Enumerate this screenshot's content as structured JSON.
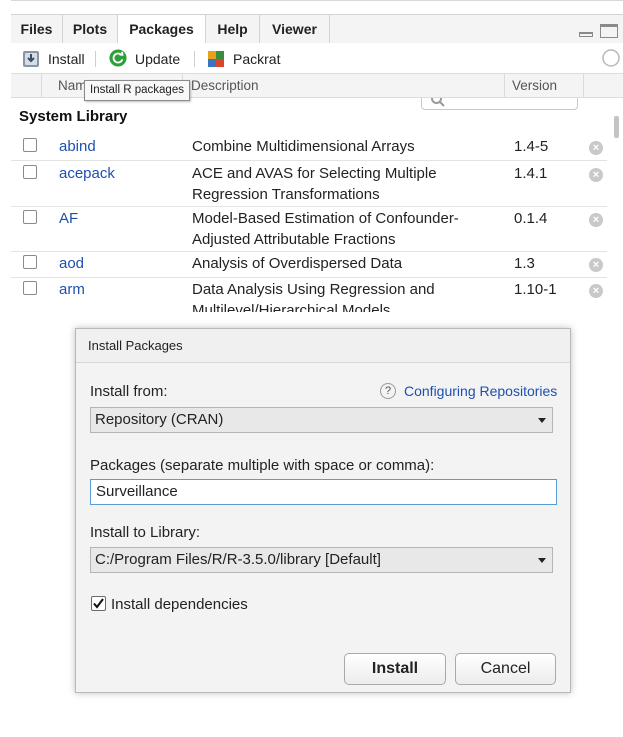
{
  "tabs": [
    {
      "label": "Files",
      "active": false
    },
    {
      "label": "Plots",
      "active": false
    },
    {
      "label": "Packages",
      "active": true
    },
    {
      "label": "Help",
      "active": false
    },
    {
      "label": "Viewer",
      "active": false
    }
  ],
  "toolbar": {
    "install_label": "Install",
    "update_label": "Update",
    "packrat_label": "Packrat",
    "tooltip": "Install R packages"
  },
  "table": {
    "col_name": "Nam",
    "col_description": "Description",
    "col_version": "Version",
    "section_label": "System Library",
    "rows": [
      {
        "name": "abind",
        "description_lines": [
          "Combine Multidimensional Arrays"
        ],
        "version": "1.4-5"
      },
      {
        "name": "acepack",
        "description_lines": [
          "ACE and AVAS for Selecting Multiple",
          "Regression Transformations"
        ],
        "version": "1.4.1"
      },
      {
        "name": "AF",
        "description_lines": [
          "Model-Based Estimation of Confounder-",
          "Adjusted Attributable Fractions"
        ],
        "version": "0.1.4"
      },
      {
        "name": "aod",
        "description_lines": [
          "Analysis of Overdispersed Data"
        ],
        "version": "1.3"
      },
      {
        "name": "arm",
        "description_lines": [
          "Data Analysis Using Regression and",
          "Multilevel/Hierarchical Models"
        ],
        "version": "1.10-1"
      }
    ]
  },
  "dialog": {
    "title": "Install Packages",
    "install_from_label": "Install from:",
    "configuring_link": "Configuring Repositories",
    "install_from_value": "Repository (CRAN)",
    "packages_label": "Packages (separate multiple with space or comma):",
    "packages_value": "Surveillance",
    "library_label": "Install to Library:",
    "library_value": "C:/Program Files/R/R-3.5.0/library [Default]",
    "dependencies_label": "Install dependencies",
    "dependencies_checked": true,
    "install_button": "Install",
    "cancel_button": "Cancel"
  },
  "colors": {
    "link": "#1f4fb0",
    "focus_border": "#5b9bd5",
    "update_icon": "#2e9e3a"
  }
}
